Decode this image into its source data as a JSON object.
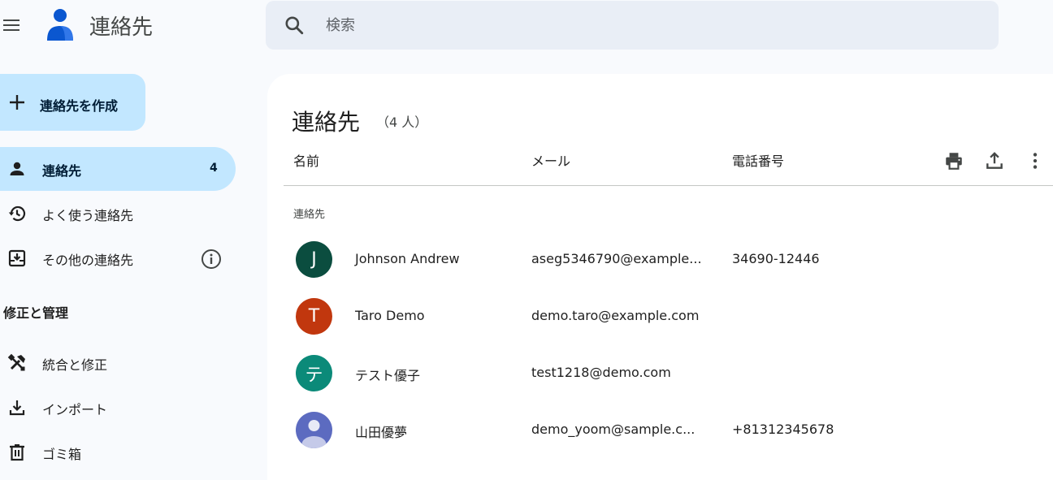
{
  "header": {
    "app_title": "連絡先",
    "search_placeholder": "検索"
  },
  "sidebar": {
    "create_label": "連絡先を作成",
    "items": [
      {
        "label": "連絡先",
        "count": "4",
        "icon": "person-icon",
        "active": true
      },
      {
        "label": "よく使う連絡先",
        "icon": "history-icon"
      },
      {
        "label": "その他の連絡先",
        "icon": "inbox-download-icon"
      }
    ],
    "section_heading": "修正と管理",
    "manage_items": [
      {
        "label": "統合と修正",
        "icon": "tools-icon"
      },
      {
        "label": "インポート",
        "icon": "download-icon"
      },
      {
        "label": "ゴミ箱",
        "icon": "trash-icon"
      }
    ]
  },
  "main": {
    "title": "連絡先",
    "count_label": "（4 人）",
    "columns": {
      "name": "名前",
      "email": "メール",
      "phone": "電話番号"
    },
    "toolbar_icons": [
      "print-icon",
      "export-icon",
      "more-vert-icon"
    ],
    "group_label": "連絡先",
    "contacts": [
      {
        "initial": "J",
        "name": "Johnson Andrew",
        "email": "aseg5346790@example...",
        "phone": "34690-12446",
        "color": "#0b4d3f"
      },
      {
        "initial": "T",
        "name": "Taro Demo",
        "email": "demo.taro@example.com",
        "phone": "",
        "color": "#c1370e"
      },
      {
        "initial": "テ",
        "name": "テスト優子",
        "email": "test1218@demo.com",
        "phone": "",
        "color": "#0b8a79"
      },
      {
        "initial": "",
        "name": "山田優夢",
        "email": "demo_yoom@sample.c...",
        "phone": "+81312345678",
        "color": "#5c6bc0"
      }
    ]
  },
  "colors": {
    "background": "#f8fafd",
    "active_nav": "#c2e7ff",
    "search_bg": "#e9eef6",
    "panel": "#ffffff"
  }
}
